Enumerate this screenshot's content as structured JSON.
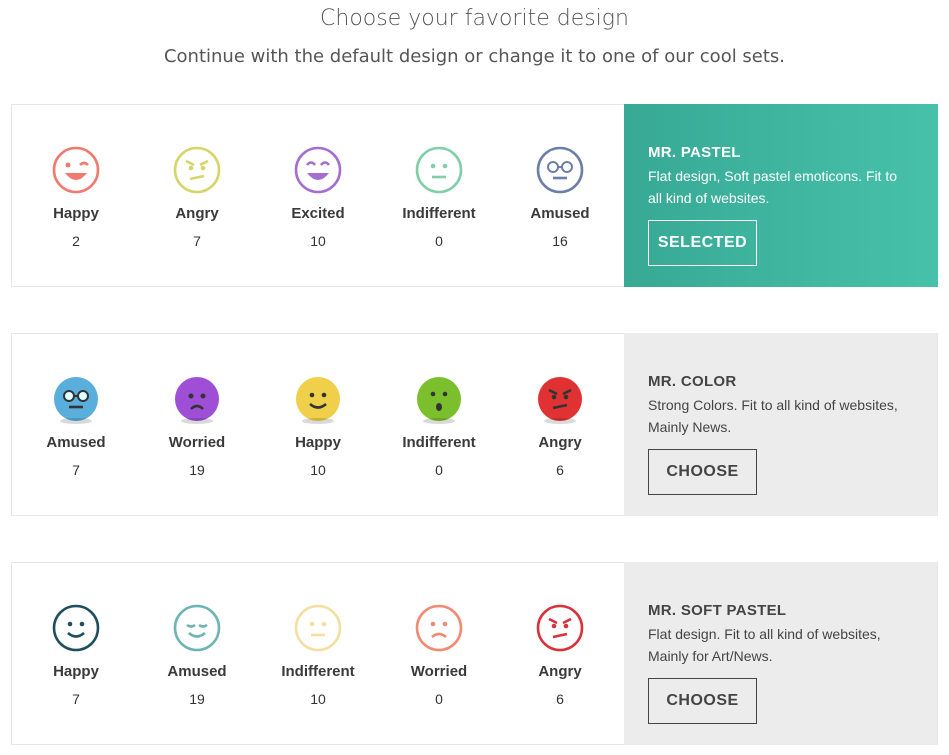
{
  "header": {
    "title": "Choose your favorite design",
    "subtitle": "Continue with the default design or change it to one of our cool sets."
  },
  "sets": [
    {
      "name": "MR. PASTEL",
      "description": "Flat design, Soft pastel emoticons. Fit to all kind of websites.",
      "button": "SELECTED",
      "selected": true,
      "emoticons": [
        {
          "label": "Happy",
          "count": "2",
          "icon": "winking-face-icon",
          "color": "#f07a6e"
        },
        {
          "label": "Angry",
          "count": "7",
          "icon": "angry-face-icon",
          "color": "#d4d66a"
        },
        {
          "label": "Excited",
          "count": "10",
          "icon": "excited-face-icon",
          "color": "#a46ed0"
        },
        {
          "label": "Indifferent",
          "count": "0",
          "icon": "neutral-face-icon",
          "color": "#7fcfa8"
        },
        {
          "label": "Amused",
          "count": "16",
          "icon": "glasses-face-icon",
          "color": "#6b7fa8"
        }
      ]
    },
    {
      "name": "MR. COLOR",
      "description": "Strong Colors. Fit to all kind of websites, Mainly News.",
      "button": "CHOOSE",
      "selected": false,
      "emoticons": [
        {
          "label": "Amused",
          "count": "7",
          "icon": "glasses-face-icon",
          "color": "#5aaedb"
        },
        {
          "label": "Worried",
          "count": "19",
          "icon": "worried-face-icon",
          "color": "#9e4fd6"
        },
        {
          "label": "Happy",
          "count": "10",
          "icon": "smiling-face-icon",
          "color": "#f0cf4a"
        },
        {
          "label": "Indifferent",
          "count": "0",
          "icon": "surprised-face-icon",
          "color": "#7cbf2c"
        },
        {
          "label": "Angry",
          "count": "6",
          "icon": "angry-face-icon",
          "color": "#e03232"
        }
      ]
    },
    {
      "name": "MR. SOFT PASTEL",
      "description": "Flat design. Fit to all kind of websites, Mainly for Art/News.",
      "button": "CHOOSE",
      "selected": false,
      "emoticons": [
        {
          "label": "Happy",
          "count": "7",
          "icon": "smiling-face-icon",
          "color": "#1f4f5e"
        },
        {
          "label": "Amused",
          "count": "19",
          "icon": "content-face-icon",
          "color": "#6fb4b4"
        },
        {
          "label": "Indifferent",
          "count": "10",
          "icon": "neutral-face-icon",
          "color": "#f3dfa0"
        },
        {
          "label": "Worried",
          "count": "0",
          "icon": "sad-face-icon",
          "color": "#f08a70"
        },
        {
          "label": "Angry",
          "count": "6",
          "icon": "angry-face-icon",
          "color": "#d8323c"
        }
      ]
    }
  ]
}
